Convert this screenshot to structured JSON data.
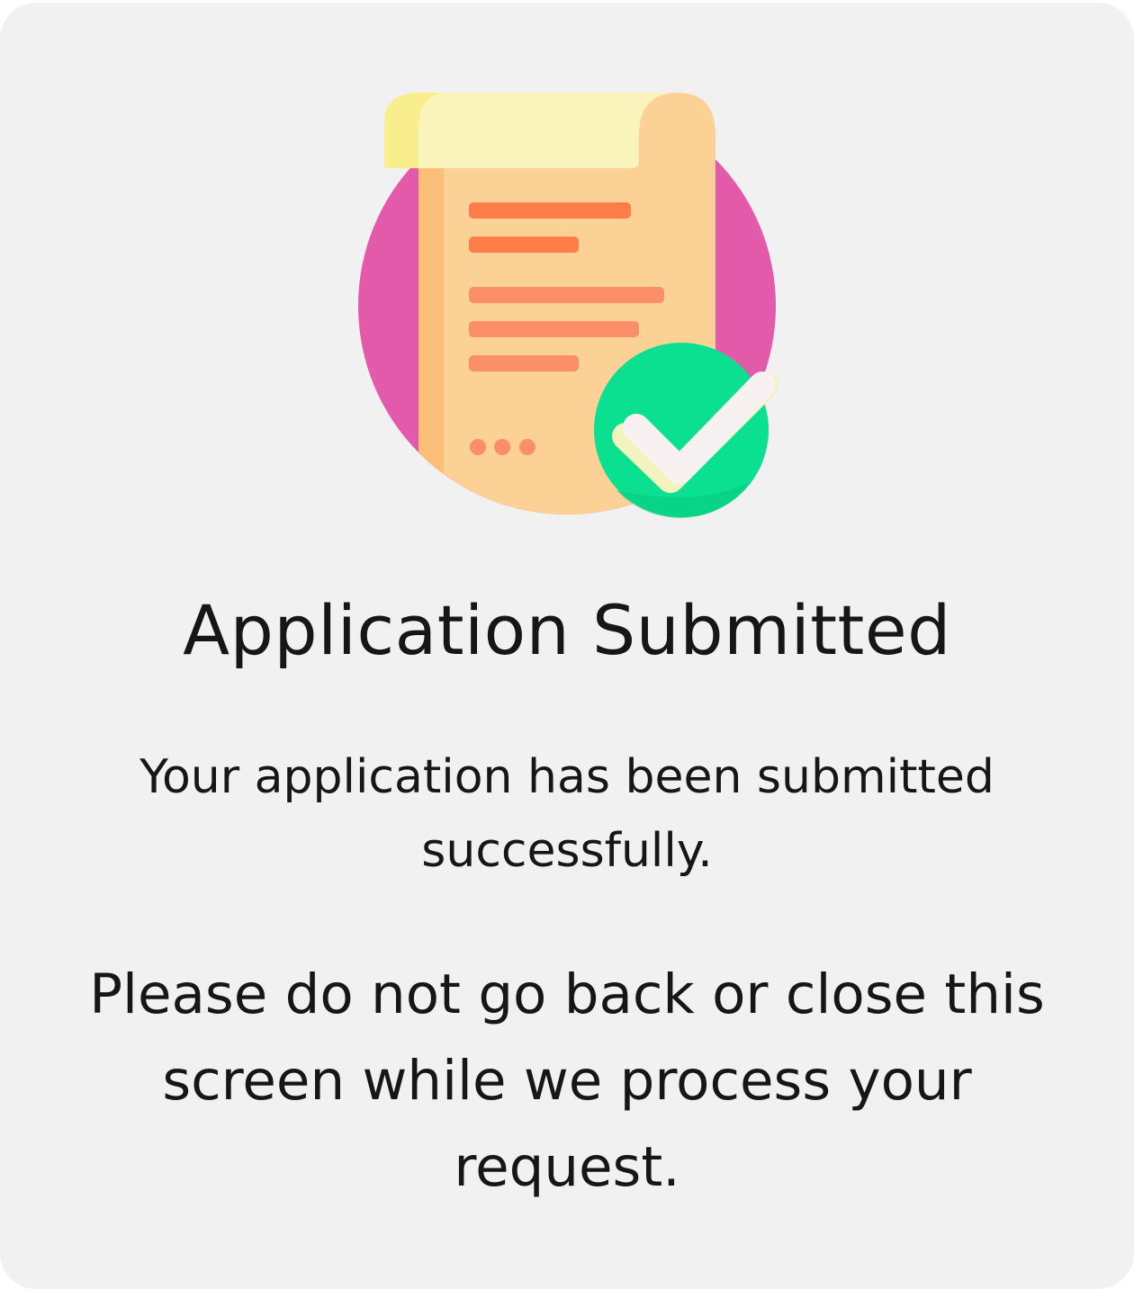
{
  "confirmation": {
    "illustration_icon": "document-approved-icon",
    "title": "Application Submitted",
    "message": "Your application has been submitted successfully.",
    "notice": "Please do not go back or close this screen while we process your request."
  },
  "colors": {
    "card_background": "#f1f1f1",
    "text": "#161616",
    "circle": "#e45aab",
    "paper": "#fcd196",
    "paper_shadow": "#fbbf78",
    "scroll_top": "#fbf3bc",
    "scroll_top_edge": "#f8ee8e",
    "line_dark": "#fe7d48",
    "line_light": "#fc8f6a",
    "check_circle": "#0ae08f",
    "check_mark": "#f8f1f1"
  }
}
